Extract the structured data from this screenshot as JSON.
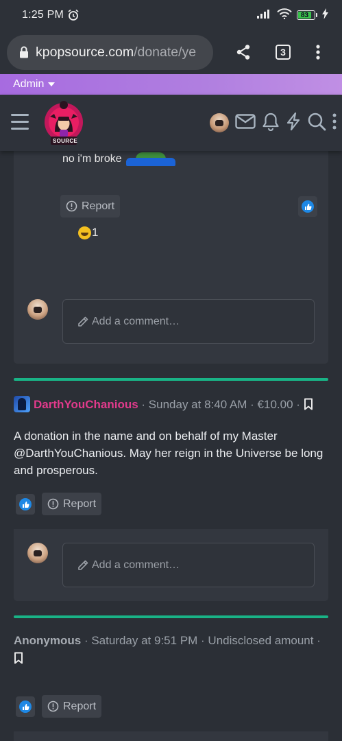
{
  "status_bar": {
    "time": "1:25 PM",
    "battery": "83"
  },
  "browser": {
    "domain": "kpopsource.com",
    "path": "/donate/ye",
    "tab_count": "3"
  },
  "admin_bar": {
    "label": "Admin"
  },
  "header": {
    "logo_text": "SOURCE"
  },
  "thread": {
    "comment_text": "no i'm broke",
    "report_label": "Report",
    "reaction_count": "1",
    "comment_placeholder": "Add a comment…"
  },
  "donations": [
    {
      "donor": "DarthYouChanious",
      "meta": " · Sunday at 8:40 AM · €10.00 · ",
      "message": "A donation in the name and on behalf of my Master @DarthYouChanious. May her reign in the Universe be long and prosperous.",
      "report_label": "Report",
      "comment_placeholder": "Add a comment…"
    },
    {
      "donor": "Anonymous",
      "meta": " · Saturday at 9:51 PM · Undisclosed amount · ",
      "report_label": "Report"
    }
  ],
  "colors": {
    "accent_green": "#19b386",
    "donor_pink": "#e23a8c",
    "admin_purple": "#a76be0",
    "like_blue": "#1e88e5"
  }
}
